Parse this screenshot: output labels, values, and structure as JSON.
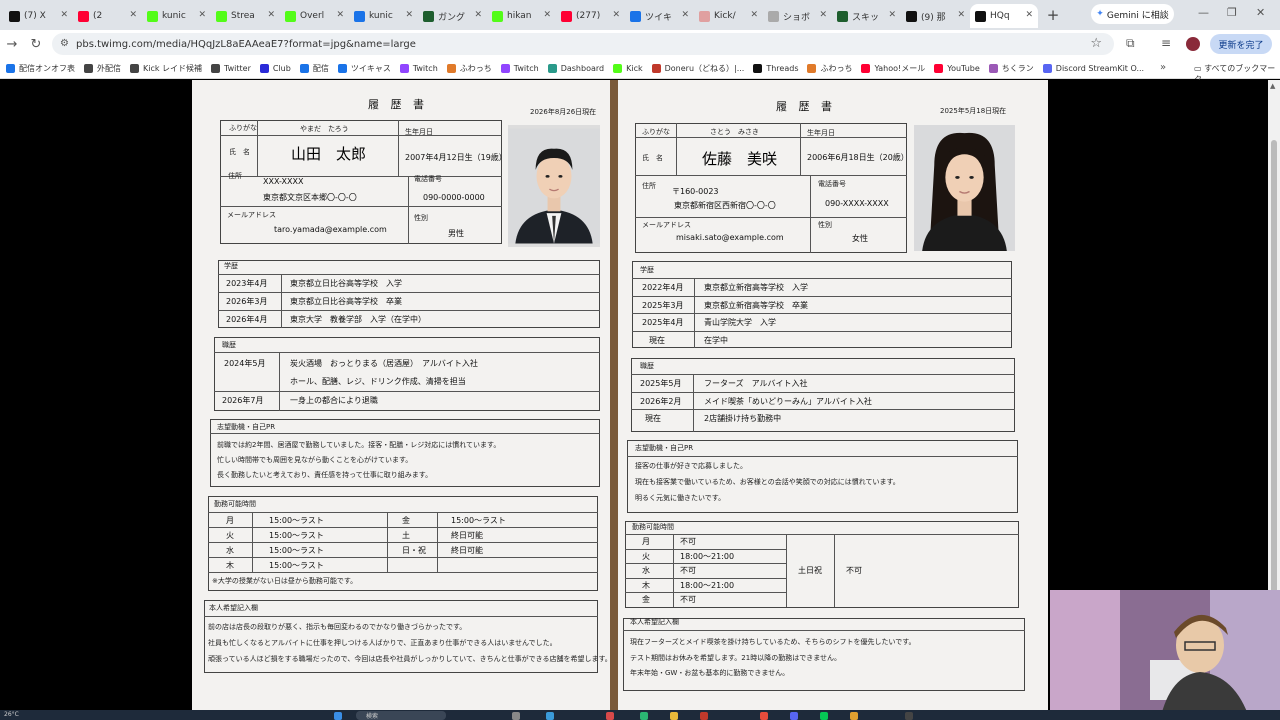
{
  "tabs": [
    {
      "title": "(7) X",
      "icon": "x-logo-icon",
      "color": "#111111"
    },
    {
      "title": "(2 ",
      "icon": "youtube-icon",
      "color": "#ff0033"
    },
    {
      "title": "kunic",
      "icon": "kick-icon",
      "color": "#53fc18"
    },
    {
      "title": "Strea",
      "icon": "kick-icon",
      "color": "#53fc18"
    },
    {
      "title": "Overl",
      "icon": "kick-icon",
      "color": "#53fc18"
    },
    {
      "title": "kunic",
      "icon": "loading-icon",
      "color": "#1a73e8"
    },
    {
      "title": "ガング",
      "icon": "site-icon",
      "color": "#1e5e2e"
    },
    {
      "title": "hikan",
      "icon": "kick-icon",
      "color": "#53fc18"
    },
    {
      "title": "(277)",
      "icon": "youtube-icon",
      "color": "#ff0033"
    },
    {
      "title": "ツイキ",
      "icon": "loading-icon",
      "color": "#1a73e8"
    },
    {
      "title": "Kick/",
      "icon": "site-icon",
      "color": "#e0a0a0"
    },
    {
      "title": "ショボ",
      "icon": "site-icon",
      "color": "#aaaaaa"
    },
    {
      "title": "スキッ",
      "icon": "site-icon",
      "color": "#1e5e2e"
    },
    {
      "title": "(9) 那",
      "icon": "x-logo-icon",
      "color": "#111111"
    },
    {
      "title": "HQq",
      "icon": "x-logo-icon",
      "color": "#111111",
      "active": true
    }
  ],
  "gemini_label": "Gemini に相談",
  "url": "pbs.twimg.com/media/HQqJzL8aEAAeaE7?format=jpg&name=large",
  "update_label": "更新を完了",
  "bookmarks": [
    {
      "label": "配信オンオフ表",
      "color": "#1a73e8"
    },
    {
      "label": "外配信",
      "color": "#444444"
    },
    {
      "label": "Kick レイド候補",
      "color": "#444444"
    },
    {
      "label": "Twitter",
      "color": "#444444"
    },
    {
      "label": "Club",
      "color": "#2b2bd8"
    },
    {
      "label": "配信",
      "color": "#1a73e8"
    },
    {
      "label": "ツイキャス",
      "color": "#1a73e8"
    },
    {
      "label": "Twitch",
      "color": "#9146ff"
    },
    {
      "label": "ふわっち",
      "color": "#e07a2a"
    },
    {
      "label": "Twitch",
      "color": "#9146ff"
    },
    {
      "label": "Dashboard",
      "color": "#2a9a8a"
    },
    {
      "label": "Kick",
      "color": "#53fc18"
    },
    {
      "label": "Doneru（どねる）|...",
      "color": "#c0392b"
    },
    {
      "label": "Threads",
      "color": "#111111"
    },
    {
      "label": "ふわっち",
      "color": "#e07a2a"
    },
    {
      "label": "Yahoo!メール",
      "color": "#ff0033"
    },
    {
      "label": "YouTube",
      "color": "#ff0033"
    },
    {
      "label": "ちくラン",
      "color": "#9b59b6"
    },
    {
      "label": "Discord StreamKit O...",
      "color": "#5865f2"
    }
  ],
  "bookmarks_all": "すべてのブックマーク",
  "resume_left": {
    "title": "履 歴 書",
    "date": "2026年8月26日現在",
    "furigana_label": "ふりがな",
    "furigana": "やまだ　たろう",
    "name_label": "氏　名",
    "name": "山田　太郎",
    "birth_label": "生年月日",
    "birth": "2007年4月12日生（19歳）",
    "address_label": "住所",
    "zip": "XXX-XXXX",
    "address": "東京都文京区本郷〇-〇-〇",
    "phone_label": "電話番号",
    "phone": "090-0000-0000",
    "email_label": "メールアドレス",
    "email": "taro.yamada@example.com",
    "gender_label": "性別",
    "gender": "男性",
    "edu_header": "学歴",
    "education": [
      {
        "date": "2023年4月",
        "text": "東京都立日比谷高等学校　入学"
      },
      {
        "date": "2026年3月",
        "text": "東京都立日比谷高等学校　卒業"
      },
      {
        "date": "2026年4月",
        "text": "東京大学　教養学部　入学（在学中）"
      }
    ],
    "work_header": "職歴",
    "work": [
      {
        "date": "2024年5月",
        "text": "炭火酒場　おっとりまる（居酒屋）　アルバイト入社"
      },
      {
        "date": "",
        "text": "ホール、配膳、レジ、ドリンク作成、清掃を担当"
      },
      {
        "date": "2026年7月",
        "text": "一身上の都合により退職"
      }
    ],
    "pr_header": "志望動機・自己PR",
    "pr": [
      "前職では約2年間、居酒屋で勤務していました。接客・配膳・レジ対応には慣れています。",
      "忙しい時間帯でも周囲を見ながら動くことを心がけています。",
      "長く勤務したいと考えており、責任感を持って仕事に取り組みます。"
    ],
    "hours_header": "勤務可能時間",
    "hours": [
      {
        "day": "月",
        "time": "15:00〜ラスト",
        "day2": "金",
        "time2": "15:00〜ラスト"
      },
      {
        "day": "火",
        "time": "15:00〜ラスト",
        "day2": "土",
        "time2": "終日可能"
      },
      {
        "day": "水",
        "time": "15:00〜ラスト",
        "day2": "日・祝",
        "time2": "終日可能"
      },
      {
        "day": "木",
        "time": "15:00〜ラスト",
        "day2": "",
        "time2": ""
      }
    ],
    "hours_note": "※大学の授業がない日は昼から勤務可能です。",
    "wish_header": "本人希望記入欄",
    "wish": [
      "前の店は店長の段取りが悪く、指示も毎回変わるのでかなり働きづらかったです。",
      "社員も忙しくなるとアルバイトに仕事を押しつける人ばかりで、正直あまり仕事ができる人はいませんでした。",
      "頑張っている人ほど損をする職場だったので、今回は店長や社員がしっかりしていて、きちんと仕事ができる店舗を希望します。"
    ]
  },
  "resume_right": {
    "title": "履 歴 書",
    "date": "2025年5月18日現在",
    "furigana_label": "ふりがな",
    "furigana": "さとう　みさき",
    "name_label": "氏　名",
    "name": "佐藤　美咲",
    "birth_label": "生年月日",
    "birth": "2006年6月18日生（20歳）",
    "address_label": "住所",
    "zip": "〒160-0023",
    "address": "東京都新宿区西新宿〇-〇-〇",
    "phone_label": "電話番号",
    "phone": "090-XXXX-XXXX",
    "email_label": "メールアドレス",
    "email": "misaki.sato@example.com",
    "gender_label": "性別",
    "gender": "女性",
    "edu_header": "学歴",
    "education": [
      {
        "date": "2022年4月",
        "text": "東京都立新宿高等学校　入学"
      },
      {
        "date": "2025年3月",
        "text": "東京都立新宿高等学校　卒業"
      },
      {
        "date": "2025年4月",
        "text": "青山学院大学　入学"
      },
      {
        "date": "現在",
        "text": "在学中"
      }
    ],
    "work_header": "職歴",
    "work": [
      {
        "date": "2025年5月",
        "text": "フーターズ　アルバイト入社"
      },
      {
        "date": "2026年2月",
        "text": "メイド喫茶「めいどりーみん」アルバイト入社"
      },
      {
        "date": "現在",
        "text": "2店舗掛け持ち勤務中"
      }
    ],
    "pr_header": "志望動機・自己PR",
    "pr": [
      "接客の仕事が好きで応募しました。",
      "現在も接客業で働いているため、お客様との会話や笑顔での対応には慣れています。",
      "明るく元気に働きたいです。"
    ],
    "hours_header": "勤務可能時間",
    "hours": [
      {
        "day": "月",
        "time": "不可"
      },
      {
        "day": "火",
        "time": "18:00〜21:00"
      },
      {
        "day": "水",
        "time": "不可"
      },
      {
        "day": "木",
        "time": "18:00〜21:00"
      },
      {
        "day": "金",
        "time": "不可"
      }
    ],
    "weekend_label": "土日祝",
    "weekend_value": "不可",
    "wish_header": "本人希望記入欄",
    "wish": [
      "現在フーターズとメイド喫茶を掛け持ちしているため、そちらのシフトを優先したいです。",
      "テスト期間はお休みを希望します。21時以降の勤務はできません。",
      "年末年始・GW・お盆も基本的に勤務できません。"
    ]
  },
  "taskbar": {
    "temp": "26°C",
    "search": "検索"
  }
}
